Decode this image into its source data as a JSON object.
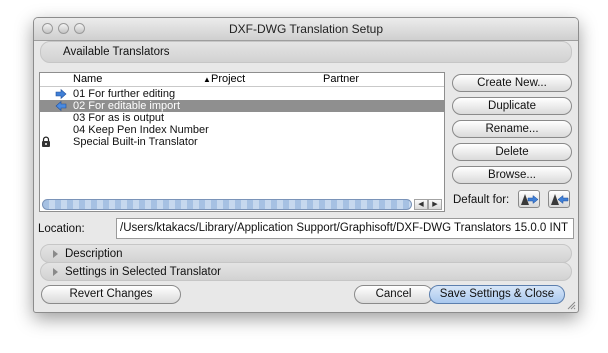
{
  "window": {
    "title": "DXF-DWG Translation Setup"
  },
  "available_translators": {
    "section_label": "Available Translators",
    "columns": [
      "Name",
      "Project",
      "Partner"
    ],
    "rows": [
      {
        "name": "01 For further editing",
        "icon": "arrow-right-icon",
        "selected": false
      },
      {
        "name": "02 For editable import",
        "icon": "arrow-left-icon",
        "selected": true
      },
      {
        "name": "03 For as is output",
        "icon": "",
        "selected": false
      },
      {
        "name": "04 Keep Pen Index Number",
        "icon": "",
        "selected": false
      },
      {
        "name": "Special Built-in Translator",
        "icon": "lock-icon",
        "selected": false
      }
    ]
  },
  "buttons": {
    "create_new": "Create New...",
    "duplicate": "Duplicate",
    "rename": "Rename...",
    "delete": "Delete",
    "browse": "Browse...",
    "default_for": "Default for:",
    "revert": "Revert Changes",
    "cancel": "Cancel",
    "save": "Save Settings & Close"
  },
  "location": {
    "label": "Location:",
    "value": "/Users/ktakacs/Library/Application Support/Graphisoft/DXF-DWG Translators 15.0.0 INT"
  },
  "sections": {
    "description": "Description",
    "settings": "Settings in Selected Translator"
  },
  "colors": {
    "selection": "#8f8f8f",
    "scroll_blue": "#a6c1e3",
    "default_button": "#a9c8ee"
  }
}
